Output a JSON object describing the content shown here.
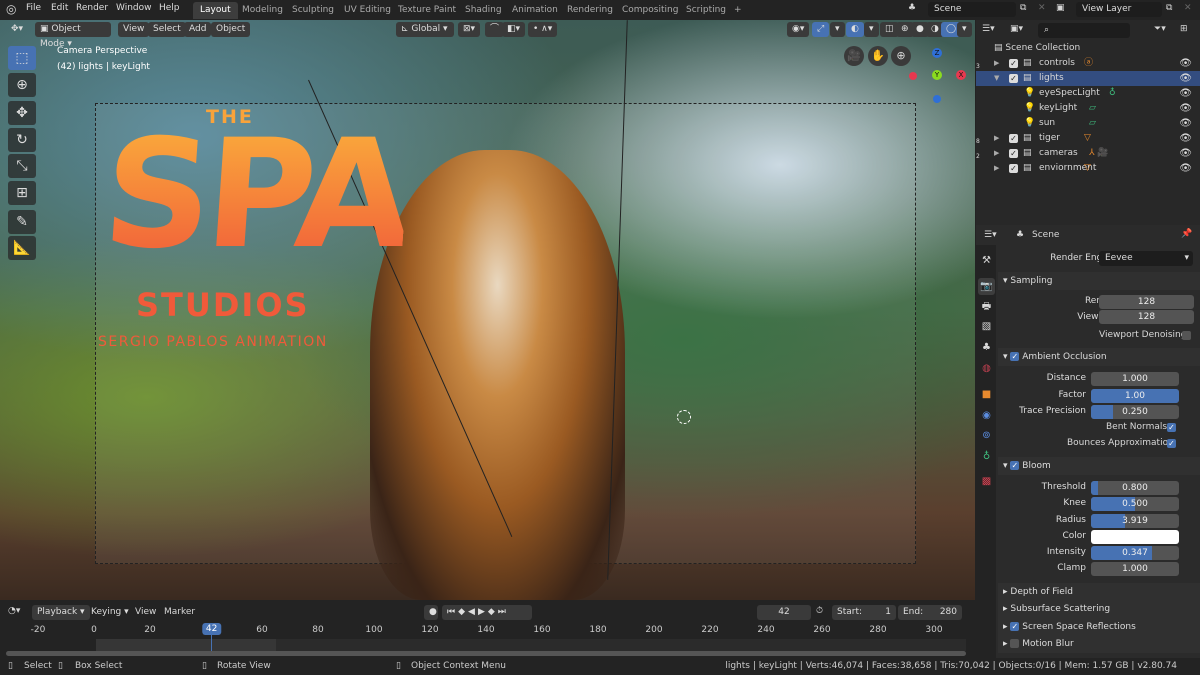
{
  "topbar": {
    "menus": [
      "File",
      "Edit",
      "Render",
      "Window",
      "Help"
    ],
    "workspaces": [
      "Layout",
      "Modeling",
      "Sculpting",
      "UV Editing",
      "Texture Paint",
      "Shading",
      "Animation",
      "Rendering",
      "Compositing",
      "Scripting",
      "+"
    ],
    "active_workspace": "Layout",
    "scene": "Scene",
    "view_layer": "View Layer"
  },
  "viewport": {
    "mode": "Object Mode",
    "menus": [
      "View",
      "Select",
      "Add",
      "Object"
    ],
    "transform_orientation": "Global",
    "info_line1": "Camera Perspective",
    "info_line2": "(42) lights | keyLight",
    "gizmo_axes": {
      "z": "Z",
      "y": "Y",
      "x": "X"
    },
    "tools": [
      "select-box",
      "cursor",
      "move",
      "rotate",
      "scale",
      "transform",
      "annotate",
      "measure"
    ],
    "logo": {
      "the": "THE",
      "spa": "SPA",
      "studios": "STUDIOS",
      "tagline": "SERGIO PABLOS ANIMATION"
    }
  },
  "outliner": {
    "root": "Scene Collection",
    "items": [
      {
        "name": "controls",
        "depth": 0,
        "expanded": false,
        "badge": "3"
      },
      {
        "name": "lights",
        "depth": 0,
        "expanded": true,
        "selected": true
      },
      {
        "name": "eyeSpecLight",
        "depth": 1
      },
      {
        "name": "keyLight",
        "depth": 1,
        "active": true
      },
      {
        "name": "sun",
        "depth": 1
      },
      {
        "name": "tiger",
        "depth": 0,
        "expanded": false,
        "badge": "8"
      },
      {
        "name": "cameras",
        "depth": 0,
        "expanded": false,
        "badge": "2"
      },
      {
        "name": "enviornment",
        "depth": 0,
        "expanded": false
      }
    ]
  },
  "properties": {
    "context": "Scene",
    "render_engine_label": "Render Engine",
    "render_engine": "Eevee",
    "sampling": {
      "title": "Sampling",
      "render_label": "Render",
      "render": "128",
      "viewport_label": "Viewport",
      "viewport": "128",
      "denoise_label": "Viewport Denoising"
    },
    "ao": {
      "title": "Ambient Occlusion",
      "enabled": true,
      "fields": [
        {
          "label": "Distance",
          "value": "1.000",
          "fill": 0
        },
        {
          "label": "Factor",
          "value": "1.00",
          "fill": 1.0
        },
        {
          "label": "Trace Precision",
          "value": "0.250",
          "fill": 0.25
        }
      ],
      "bent_normals": "Bent Normals",
      "bounces": "Bounces Approximation"
    },
    "bloom": {
      "title": "Bloom",
      "enabled": true,
      "fields": [
        {
          "label": "Threshold",
          "value": "0.800",
          "fill": 0.08
        },
        {
          "label": "Knee",
          "value": "0.500",
          "fill": 0.5
        },
        {
          "label": "Radius",
          "value": "3.919",
          "fill": 0.39
        },
        {
          "label": "Intensity",
          "value": "0.347",
          "fill": 0.69
        },
        {
          "label": "Clamp",
          "value": "1.000",
          "fill": 0
        }
      ],
      "color_label": "Color",
      "color": "#ffffff"
    },
    "collapsed": [
      {
        "title": "Depth of Field"
      },
      {
        "title": "Subsurface Scattering"
      },
      {
        "title": "Screen Space Reflections",
        "checkbox": true,
        "enabled": true
      },
      {
        "title": "Motion Blur",
        "checkbox": true,
        "enabled": false
      }
    ]
  },
  "timeline": {
    "menus": [
      "Playback",
      "Keying",
      "View",
      "Marker"
    ],
    "current_frame": "42",
    "start_label": "Start:",
    "start": "1",
    "end_label": "End:",
    "end": "280",
    "ticks": [
      "-20",
      "0",
      "20",
      "42",
      "60",
      "80",
      "100",
      "120",
      "140",
      "160",
      "180",
      "200",
      "220",
      "240",
      "260",
      "280",
      "300"
    ]
  },
  "status": {
    "select": "Select",
    "box_select": "Box Select",
    "rotate": "Rotate View",
    "context_menu": "Object Context Menu",
    "stats": "lights | keyLight | Verts:46,074 | Faces:38,658 | Tris:70,042 | Objects:0/16 | Mem: 1.57 GB | v2.80.74"
  },
  "colors": {
    "accent": "#4772b3",
    "bg": "#232323",
    "panel": "#2b2b2b",
    "logo_top": "#fbb03b",
    "logo_bottom": "#f05a3a"
  }
}
